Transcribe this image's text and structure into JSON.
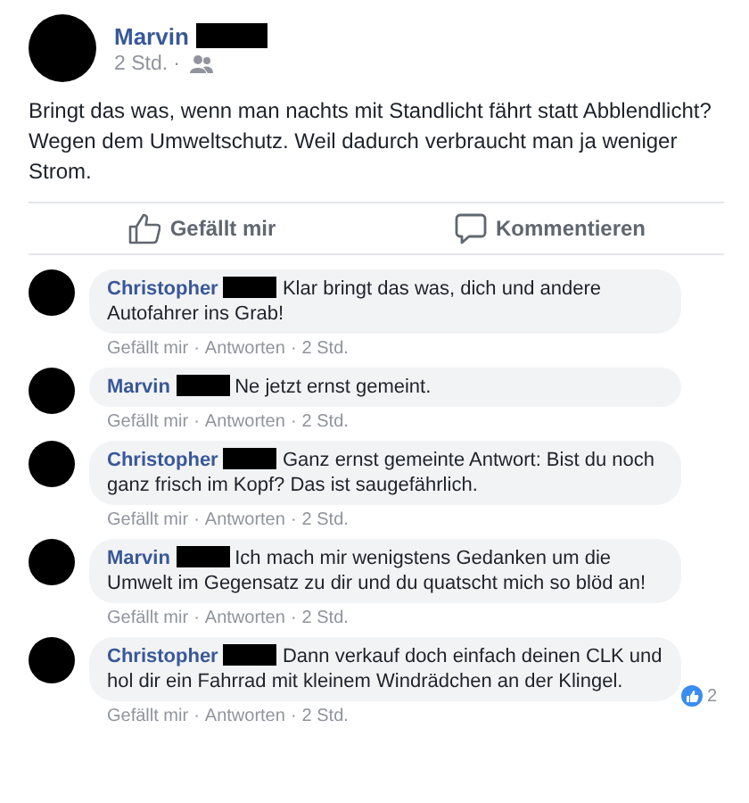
{
  "separator": "·",
  "post": {
    "author": "Marvin",
    "author_redacted": true,
    "time": "2 Std.",
    "text": "Bringt das was, wenn man nachts mit Standlicht fährt statt Abblendlicht? Wegen dem Umweltschutz. Weil dadurch verbraucht man ja weniger Strom."
  },
  "actions": [
    {
      "kind": "like",
      "label": "Gefällt mir"
    },
    {
      "kind": "comment",
      "label": "Kommentieren"
    }
  ],
  "comments": [
    {
      "author": "Christopher",
      "author_redacted": true,
      "text": "Klar bringt das was, dich und andere Autofahrer ins Grab!",
      "like": "Gefällt mir",
      "reply": "Antworten",
      "time": "2 Std."
    },
    {
      "author": "Marvin",
      "author_redacted": true,
      "text": "Ne jetzt ernst gemeint.",
      "like": "Gefällt mir",
      "reply": "Antworten",
      "time": "2 Std."
    },
    {
      "author": "Christopher",
      "author_redacted": true,
      "text": "Ganz ernst gemeinte Antwort: Bist du noch ganz frisch im Kopf? Das ist saugefährlich.",
      "like": "Gefällt mir",
      "reply": "Antworten",
      "time": "2 Std."
    },
    {
      "author": "Marvin",
      "author_redacted": true,
      "text": "Ich mach mir wenigstens Gedanken um die Umwelt im Gegensatz zu dir und du quatscht mich so blöd an!",
      "like": "Gefällt mir",
      "reply": "Antworten",
      "time": "2 Std."
    },
    {
      "author": "Christopher",
      "author_redacted": true,
      "text": "Dann verkauf doch einfach deinen CLK und hol dir ein Fahrrad mit kleinem Windrädchen an der Klingel.",
      "like": "Gefällt mir",
      "reply": "Antworten",
      "time": "2 Std.",
      "reactions": "2"
    }
  ]
}
